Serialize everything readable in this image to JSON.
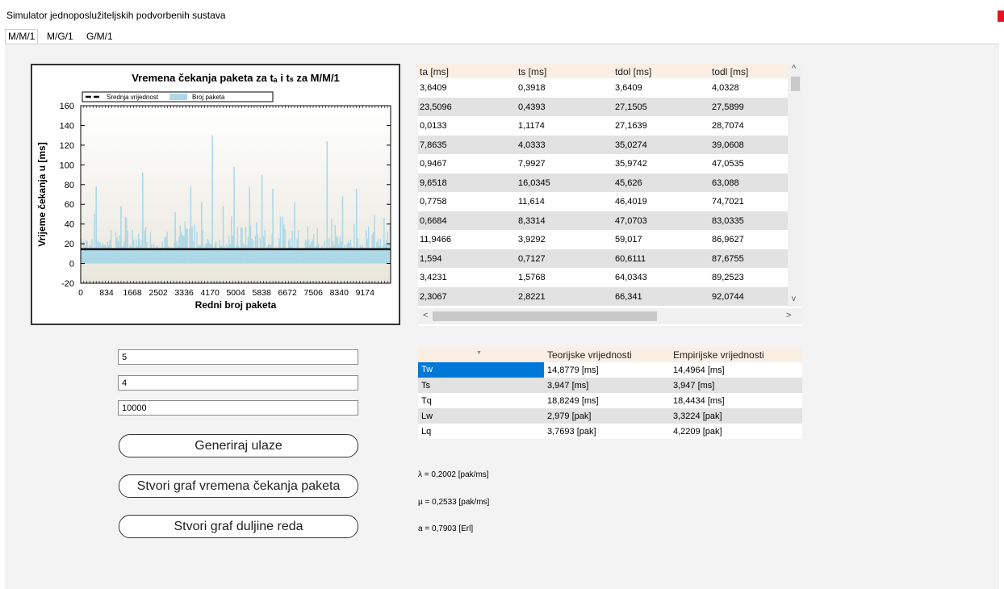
{
  "window": {
    "title": "Simulator jednoposlužiteljskih podvorbenih sustava"
  },
  "tabs": [
    {
      "label": "M/M/1"
    },
    {
      "label": "M/G/1"
    },
    {
      "label": "G/M/1"
    }
  ],
  "chart_data": {
    "type": "bar",
    "title": "Vremena čekanja paketa za tₐ i tₛ za M/M/1",
    "xlabel": "Redni broj paketa",
    "ylabel": "Vrijeme čekanja u [ms]",
    "ylim": [
      -20,
      160
    ],
    "yticks": [
      "-20",
      "0",
      "20",
      "40",
      "60",
      "80",
      "100",
      "120",
      "140",
      "160"
    ],
    "xticks": [
      "0",
      "834",
      "1668",
      "2502",
      "3336",
      "4170",
      "5004",
      "5838",
      "6672",
      "7506",
      "8340",
      "9174"
    ],
    "xlim": [
      0,
      10000
    ],
    "legend": [
      "Srednja vrijednost",
      "Broj paketa"
    ],
    "legend_position": "top",
    "mean_line_value": 14.5,
    "series": [
      {
        "name": "Broj paketa",
        "color": "#add8e6",
        "peaks": [
          [
            500,
            78
          ],
          [
            1300,
            58
          ],
          [
            2000,
            92
          ],
          [
            3050,
            52
          ],
          [
            3550,
            78
          ],
          [
            3900,
            62
          ],
          [
            4250,
            130
          ],
          [
            4600,
            58
          ],
          [
            4950,
            98
          ],
          [
            5450,
            78
          ],
          [
            5850,
            90
          ],
          [
            6200,
            76
          ],
          [
            6900,
            62
          ],
          [
            7950,
            124
          ],
          [
            8450,
            68
          ],
          [
            8900,
            76
          ]
        ]
      },
      {
        "name": "Srednja vrijednost",
        "color": "#000000",
        "values": [
          14.5
        ]
      }
    ]
  },
  "table": {
    "columns": [
      "ta [ms]",
      "ts [ms]",
      "tdol [ms]",
      "todl [ms]"
    ],
    "rows": [
      [
        "3,6409",
        "0,3918",
        "3,6409",
        "4,0328"
      ],
      [
        "23,5096",
        "0,4393",
        "27,1505",
        "27,5899"
      ],
      [
        "0,0133",
        "1,1174",
        "27,1639",
        "28,7074"
      ],
      [
        "7,8635",
        "4,0333",
        "35,0274",
        "39,0608"
      ],
      [
        "0,9467",
        "7,9927",
        "35,9742",
        "47,0535"
      ],
      [
        "9,6518",
        "16,0345",
        "45,626",
        "63,088"
      ],
      [
        "0,7758",
        "11,614",
        "46,4019",
        "74,7021"
      ],
      [
        "0,6684",
        "8,3314",
        "47,0703",
        "83,0335"
      ],
      [
        "11,9466",
        "3,9292",
        "59,017",
        "86,9627"
      ],
      [
        "1,594",
        "0,7127",
        "60,6111",
        "87,6755"
      ],
      [
        "3,4231",
        "1,5768",
        "64,0343",
        "89,2523"
      ],
      [
        "2,3067",
        "2,8221",
        "66,341",
        "92,0744"
      ]
    ],
    "scroll_up": "^",
    "scroll_down": "v",
    "scroll_left": "<",
    "scroll_right": ">"
  },
  "results": {
    "columns": [
      "",
      "Teorijske vrijednosti",
      "Empirijske vrijednosti"
    ],
    "sort_glyph": "▼",
    "rows": [
      [
        "Tw",
        "14,8779 [ms]",
        "14,4964 [ms]"
      ],
      [
        "Ts",
        "3,947 [ms]",
        "3,947 [ms]"
      ],
      [
        "Tq",
        "18,8249 [ms]",
        "18,4434 [ms]"
      ],
      [
        "Lw",
        "2,979 [pak]",
        "3,3224 [pak]"
      ],
      [
        "Lq",
        "3,7693 [pak]",
        "4,2209 [pak]"
      ]
    ]
  },
  "inputs": [
    {
      "value": "5"
    },
    {
      "value": "4"
    },
    {
      "value": "10000"
    }
  ],
  "buttons": {
    "generate": "Generiraj ulaze",
    "wait_graph": "Stvori graf vremena čekanja paketa",
    "queue_graph": "Stvori graf duljine reda"
  },
  "stats": {
    "lambda": "λ = 0,2002 [pak/ms]",
    "mu": "µ = 0,2533 [pak/ms]",
    "a": "a = 0,7903 [Erl]"
  }
}
